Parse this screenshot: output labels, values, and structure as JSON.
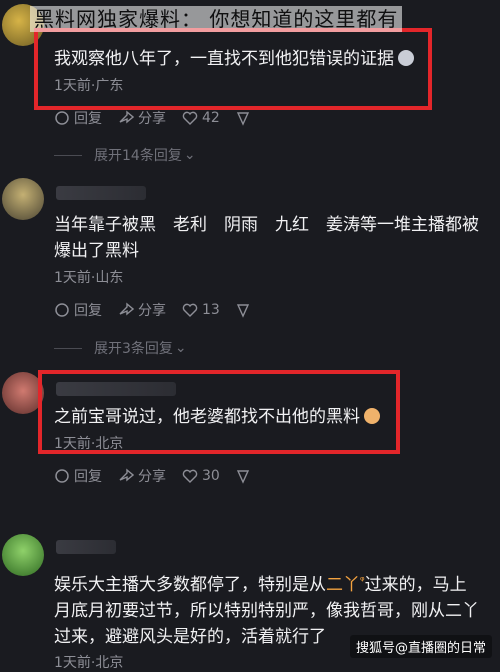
{
  "title": "黑料网独家爆料： 你想知道的这里都有",
  "comments": [
    {
      "text": "我观察他八年了，一直找不到他犯错误的证据",
      "meta": "1天前·广东",
      "actions": {
        "reply": "回复",
        "share": "分享",
        "likes": "42"
      },
      "expand": "展开14条回复"
    },
    {
      "text": "当年靠子被黑　老利　阴雨　九红　姜涛等一堆主播都被爆出了黑料",
      "meta": "1天前·山东",
      "actions": {
        "reply": "回复",
        "share": "分享",
        "likes": "13"
      },
      "expand": "展开3条回复"
    },
    {
      "text": "之前宝哥说过，他老婆都找不出他的黑料",
      "meta": "1天前·北京",
      "actions": {
        "reply": "回复",
        "share": "分享",
        "likes": "30"
      }
    },
    {
      "text_a": "娱乐大主播大多数都停了，特别是从",
      "text_hl": "二丫",
      "text_b": "过来的，马上月底月初要过节，所以特别特别严，像我哲哥，刚从二丫过来，避避风头是好的，活着就行了",
      "meta": "1天前·北京"
    }
  ],
  "watermark": "搜狐号@直播圈的日常"
}
